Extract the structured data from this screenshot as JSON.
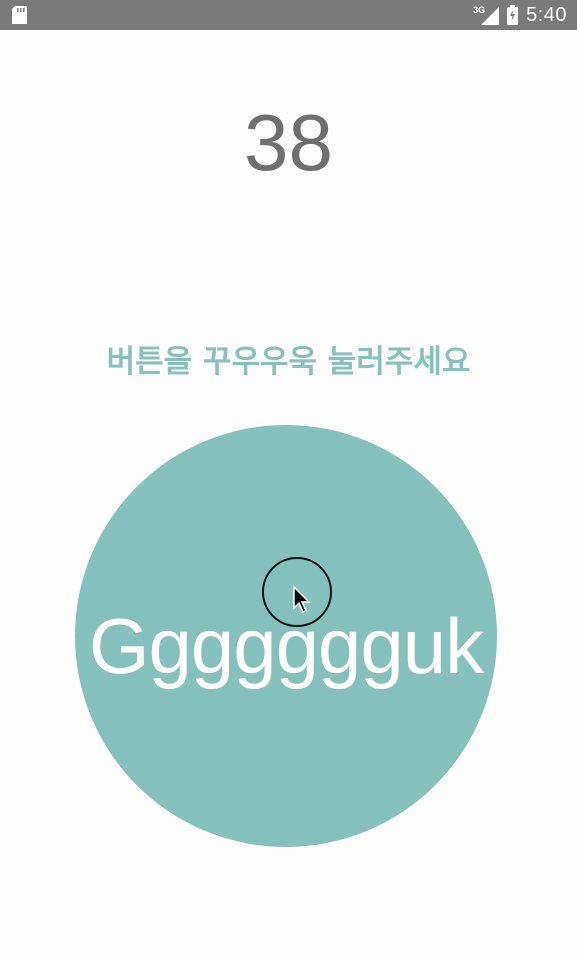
{
  "status_bar": {
    "network_label": "3G",
    "time": "5:40",
    "icons": [
      "sd-card-icon",
      "signal-icon",
      "battery-charging-icon"
    ]
  },
  "counter": {
    "value": "38"
  },
  "instruction": {
    "text": "버튼을 꾸우우욱 눌러주세요"
  },
  "button": {
    "label": "Ggggggguk"
  },
  "colors": {
    "status_bar": "#7a7a7a",
    "accent": "#84c1bc",
    "counter_text": "#6f6f6f",
    "background": "#fdfdfd"
  }
}
